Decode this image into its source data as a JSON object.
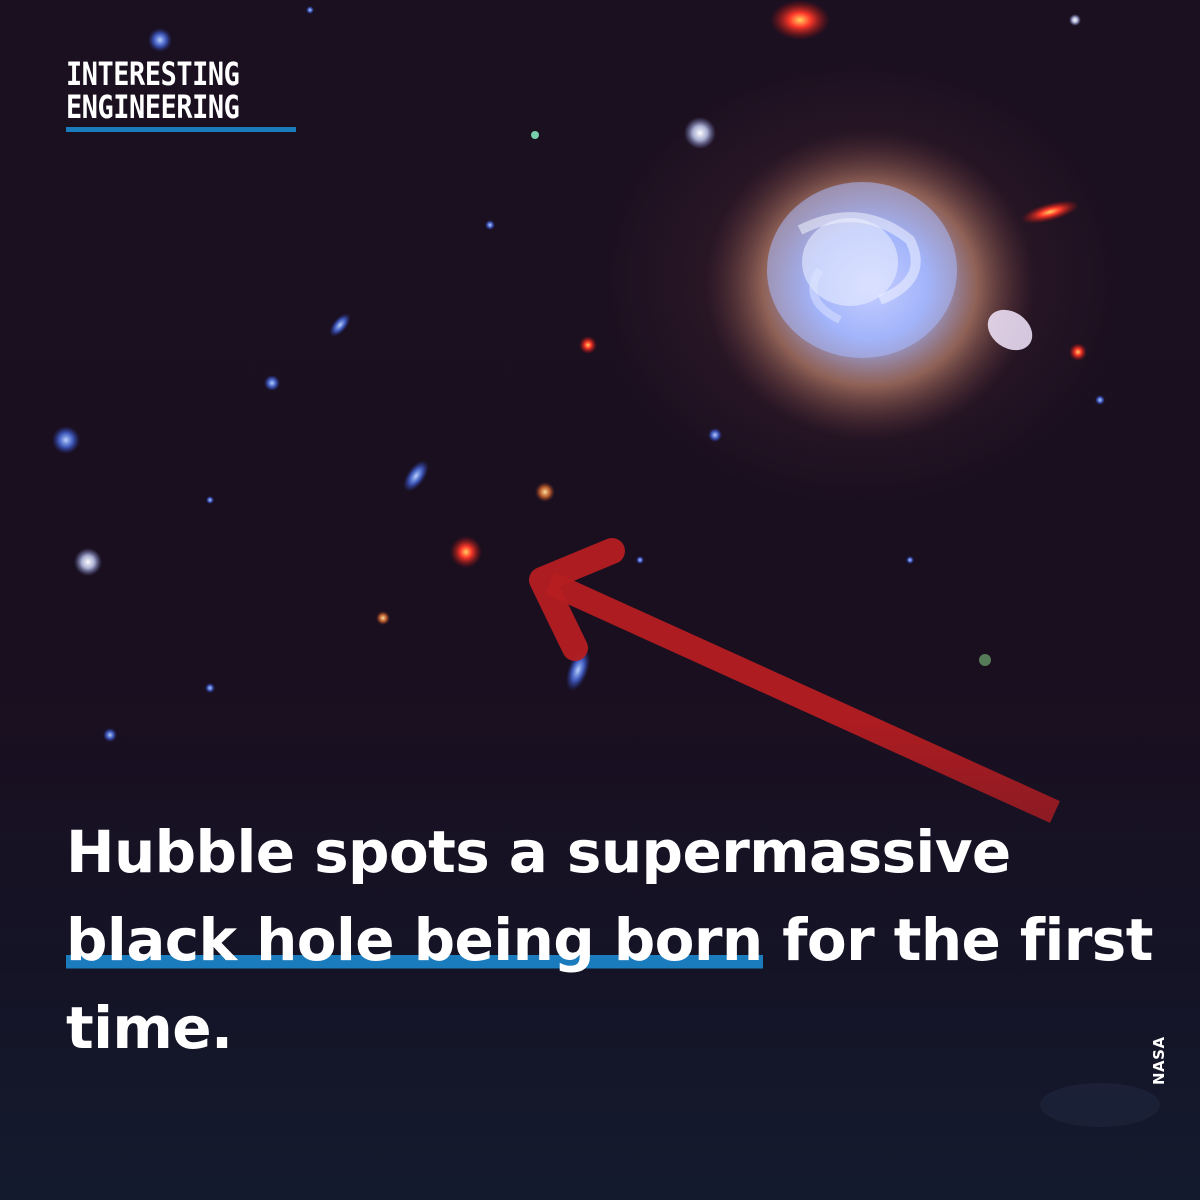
{
  "brand": {
    "line1": "INTERESTING",
    "line2": "ENGINEERING",
    "accent_color": "#1a7bbd"
  },
  "headline": {
    "line1": "Hubble spots a supermassive",
    "line2_highlight": "black hole being born",
    "line2_rest": " for the first",
    "line3": "time."
  },
  "credit": "NASA",
  "arrow": {
    "color": "#b51d22",
    "points_to": "red dot (newborn black hole)"
  }
}
